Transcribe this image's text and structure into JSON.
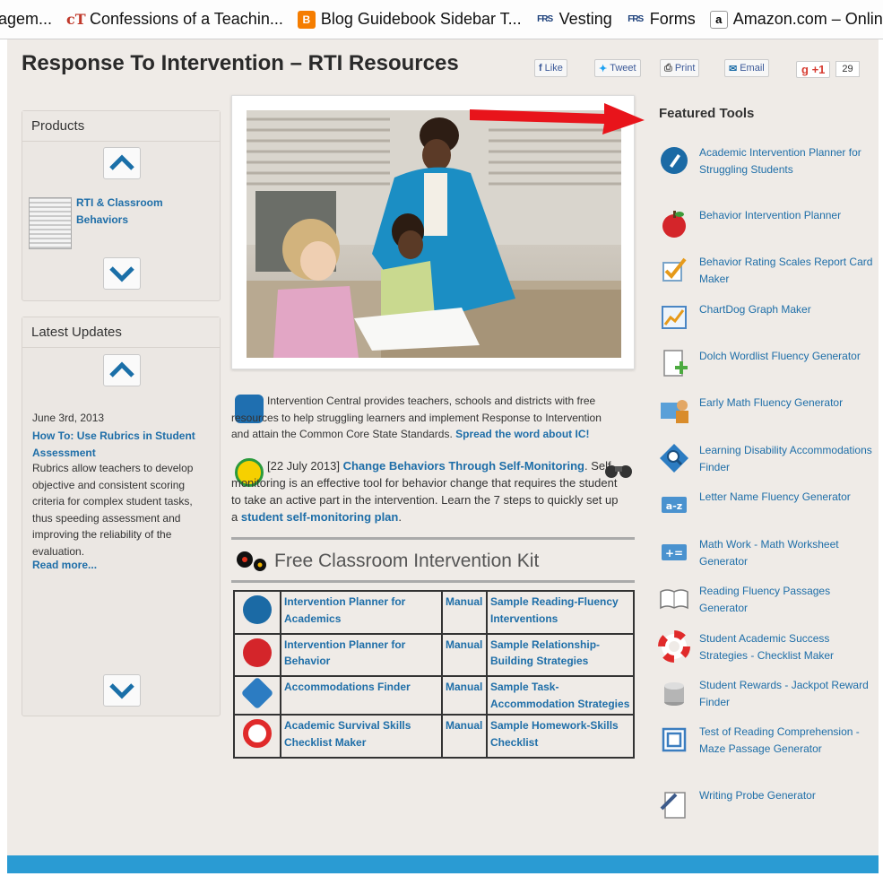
{
  "bookmarks": [
    {
      "label": "agem...",
      "icon": "page-icon"
    },
    {
      "label": "Confessions of a Teachin...",
      "icon": "ct-icon"
    },
    {
      "label": "Blog Guidebook Sidebar T...",
      "icon": "blogger-icon"
    },
    {
      "label": "Vesting",
      "icon": "frs-icon"
    },
    {
      "label": "Forms",
      "icon": "frs-icon"
    },
    {
      "label": "Amazon.com – Online Sh...",
      "icon": "amazon-icon"
    }
  ],
  "page": {
    "title": "Response To Intervention – RTI Resources",
    "share": {
      "like": "Like",
      "tweet": "Tweet",
      "print": "Print",
      "email": "Email",
      "gplus": "+1",
      "gplus_count": "29"
    }
  },
  "products": {
    "heading": "Products",
    "item": "RTI & Classroom Behaviors"
  },
  "updates": {
    "heading": "Latest Updates",
    "date": "June 3rd, 2013",
    "link": "How To: Use Rubrics in Student Assessment",
    "text": "Rubrics allow teachers to develop objective and consistent scoring criteria for complex student tasks, thus speeding assessment and improving the reliability of the evaluation.",
    "more": "Read more..."
  },
  "intro": {
    "text": "Intervention Central provides teachers, schools and districts with free resources to help struggling learners and implement Response to Intervention and attain the Common Core State Standards.",
    "link": "Spread the word about IC!"
  },
  "self_monitoring": {
    "date": "[22 July 2013]",
    "link": "Change Behaviors Through Self-Monitoring",
    "text": "Self-monitoring is an effective tool for behavior change that requires the student to take an active part in the intervention. Learn the 7 steps to quickly set up a",
    "link2": "student self-monitoring plan",
    "end": "."
  },
  "kit": {
    "title": "Free Classroom Intervention Kit",
    "rows": [
      {
        "icon": "pen-icon",
        "tool": "Intervention Planner for Academics",
        "manual": "Manual",
        "sample": "Sample Reading-Fluency Interventions"
      },
      {
        "icon": "apple-icon",
        "tool": "Intervention Planner for Behavior",
        "manual": "Manual",
        "sample": "Sample Relationship-Building Strategies"
      },
      {
        "icon": "magnifier-icon",
        "tool": "Accommodations Finder",
        "manual": "Manual",
        "sample": "Sample Task-Accommodation Strategies"
      },
      {
        "icon": "lifebuoy-icon",
        "tool": "Academic Survival Skills Checklist Maker",
        "manual": "Manual",
        "sample": "Sample Homework-Skills Checklist"
      }
    ]
  },
  "featured": {
    "heading": "Featured Tools",
    "items": [
      {
        "label": "Academic Intervention Planner for Struggling Students",
        "icon": "pen-icon"
      },
      {
        "label": "Behavior Intervention Planner",
        "icon": "apple-icon"
      },
      {
        "label": "Behavior Rating Scales Report Card Maker",
        "icon": "checkmark-icon"
      },
      {
        "label": "ChartDog Graph Maker",
        "icon": "chart-icon"
      },
      {
        "label": "Dolch Wordlist Fluency Generator",
        "icon": "document-plus-icon"
      },
      {
        "label": "Early Math Fluency Generator",
        "icon": "math-card-icon"
      },
      {
        "label": "Learning Disability Accommodations Finder",
        "icon": "magnifier-icon"
      },
      {
        "label": "Letter Name Fluency Generator",
        "icon": "a-z-icon"
      },
      {
        "label": "Math Work - Math Worksheet Generator",
        "icon": "plus-equals-icon"
      },
      {
        "label": "Reading Fluency Passages Generator",
        "icon": "book-icon"
      },
      {
        "label": "Student Academic Success Strategies - Checklist Maker",
        "icon": "lifebuoy-icon"
      },
      {
        "label": "Student Rewards - Jackpot Reward Finder",
        "icon": "coins-icon"
      },
      {
        "label": "Test of Reading Comprehension - Maze Passage Generator",
        "icon": "maze-icon"
      },
      {
        "label": "Writing Probe Generator",
        "icon": "pencil-paper-icon"
      }
    ]
  },
  "colors": {
    "link": "#1e6ea8",
    "page_bg": "#efebe7",
    "footer_bar": "#2a9bd3",
    "annotation_arrow": "#e8141b"
  }
}
